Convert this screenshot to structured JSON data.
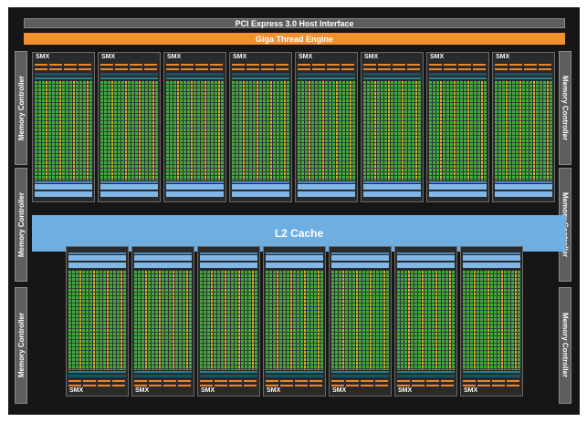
{
  "header": {
    "pcie_label": "PCI Express 3.0 Host Interface",
    "giga_label": "Giga Thread Engine"
  },
  "l2": {
    "label": "L2 Cache"
  },
  "memory_controllers": {
    "left": [
      "Memory Controller",
      "Memory Controller",
      "Memory Controller"
    ],
    "right": [
      "Memory Controller",
      "Memory Controller",
      "Memory Controller"
    ]
  },
  "smx_top": [
    "SMX",
    "SMX",
    "SMX",
    "SMX",
    "SMX",
    "SMX",
    "SMX",
    "SMX"
  ],
  "smx_bottom": [
    "SMX",
    "SMX",
    "SMX",
    "SMX",
    "SMX",
    "SMX",
    "SMX"
  ],
  "colors": {
    "background": "#161616",
    "giga_thread": "#f0902f",
    "l2_cache": "#6eaee0",
    "core_green": "#3fae3c",
    "core_yellow": "#d8b42a",
    "memory_controller": "#5e5e5e"
  }
}
